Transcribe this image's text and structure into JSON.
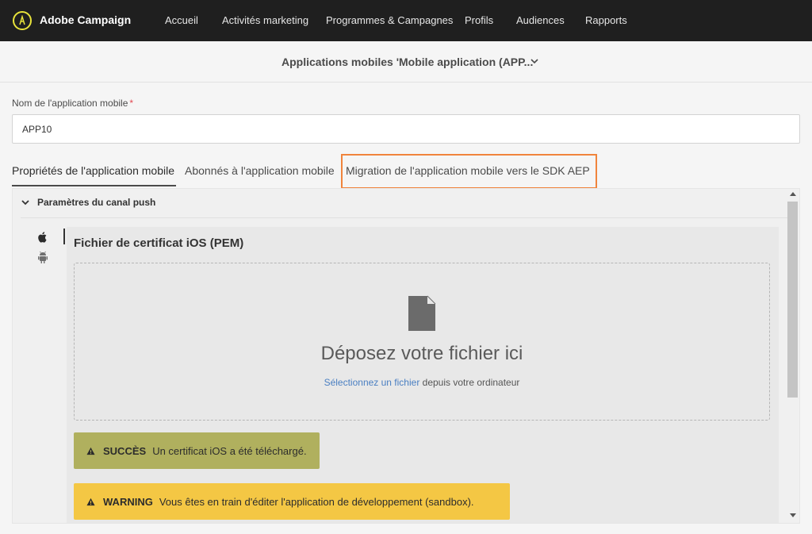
{
  "app": {
    "brand": "Adobe Campaign"
  },
  "nav": [
    {
      "label": "Accueil"
    },
    {
      "label": "Activités marketing"
    },
    {
      "label": "Programmes & Campagnes"
    },
    {
      "label": "Profils"
    },
    {
      "label": "Audiences"
    },
    {
      "label": "Rapports"
    }
  ],
  "header": {
    "title": "Applications mobiles 'Mobile application (APP..."
  },
  "form": {
    "name_label": "Nom de l'application mobile",
    "required_marker": "*",
    "name_value": "APP10"
  },
  "tabs": [
    {
      "label": "Propriétés de l'application mobile",
      "active": true
    },
    {
      "label": "Abonnés à l'application mobile",
      "active": false
    },
    {
      "label": "Migration de l'application mobile vers le SDK AEP",
      "active": false,
      "highlighted": true
    }
  ],
  "section": {
    "title": "Paramètres du canal push",
    "os_icons": [
      "apple-icon",
      "android-icon"
    ]
  },
  "certificate": {
    "title": "Fichier de certificat iOS (PEM)",
    "drop_text": "Déposez votre fichier ici",
    "select_link": "Sélectionnez un fichier",
    "select_suffix": " depuis votre ordinateur"
  },
  "alerts": {
    "success": {
      "kind": "SUCCÈS",
      "message": "Un certificat iOS a été téléchargé."
    },
    "warning": {
      "kind": "WARNING",
      "message": "Vous êtes en train d'éditer l'application de développement (sandbox)."
    }
  },
  "colors": {
    "topbar": "#1f1f1f",
    "highlight": "#f0843c",
    "success": "#b0b05e",
    "warning": "#f4c744",
    "link": "#4a7fc2"
  }
}
